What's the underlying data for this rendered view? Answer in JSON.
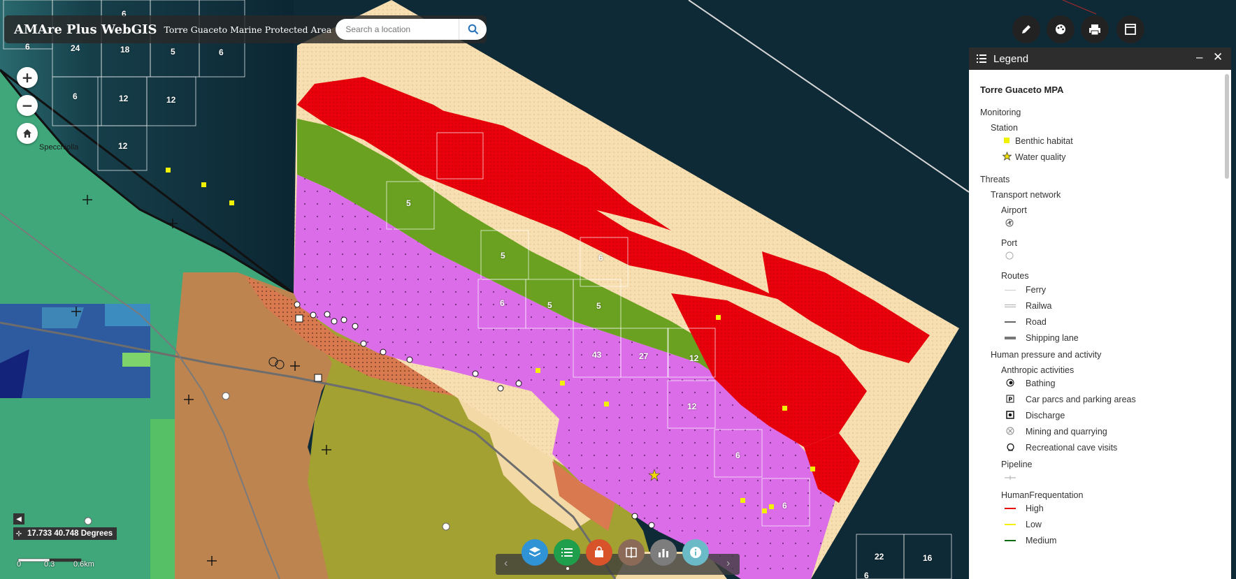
{
  "header": {
    "app_title": "AMAre Plus WebGIS",
    "subtitle": "Torre Guaceto Marine Protected Area",
    "search_placeholder": "Search a location"
  },
  "map": {
    "place_label": "Specchiolla",
    "grid_numbers_topleft": [
      "6",
      "6",
      "24",
      "18",
      "5",
      "6",
      "6",
      "12",
      "12",
      "12"
    ],
    "grid_numbers_habitat": [
      "5",
      "5",
      "6",
      "6",
      "5",
      "5",
      "43",
      "27",
      "12",
      "12",
      "6",
      "6"
    ],
    "grid_numbers_bottomright": [
      "22",
      "16",
      "6"
    ],
    "habitat_colors": {
      "red": "#e8000b",
      "sand": "#f7dfb2",
      "green": "#6aa121",
      "violet": "#db6ee8",
      "brown": "#cc8a55",
      "olive": "#a3a131",
      "orange": "#d8794f",
      "land_teal": "#3fa77a",
      "sea": "#113040"
    }
  },
  "legend": {
    "title": "Legend",
    "group_title": "Torre Guaceto MPA",
    "monitoring": "Monitoring",
    "station": "Station",
    "benthic": "Benthic habitat",
    "water_quality": "Water quality",
    "threats": "Threats",
    "transport": "Transport network",
    "airport": "Airport",
    "port": "Port",
    "routes": "Routes",
    "ferry": "Ferry",
    "railwa": "Railwa",
    "road": "Road",
    "shipping": "Shipping lane",
    "human_pressure": "Human pressure and activity",
    "anthropic": "Anthropic activities",
    "bathing": "Bathing",
    "car_parcs": "Car parcs and parking areas",
    "discharge": "Discharge",
    "mining": "Mining and quarrying",
    "cave": "Recreational cave visits",
    "pipeline": "Pipeline",
    "human_freq": "HumanFrequentation",
    "high": "High",
    "low": "Low",
    "medium": "Medium",
    "minimize": "–",
    "close": "✕"
  },
  "coords": {
    "value": "17.733 40.748 Degrees"
  },
  "scale": {
    "labels": [
      "0",
      "0.3",
      "0.6km"
    ]
  },
  "toolbar": {
    "prev": "‹",
    "next": "›"
  },
  "icons": {
    "search": "search-icon",
    "zoom_in": "+",
    "zoom_out": "−",
    "home": "home-icon"
  }
}
